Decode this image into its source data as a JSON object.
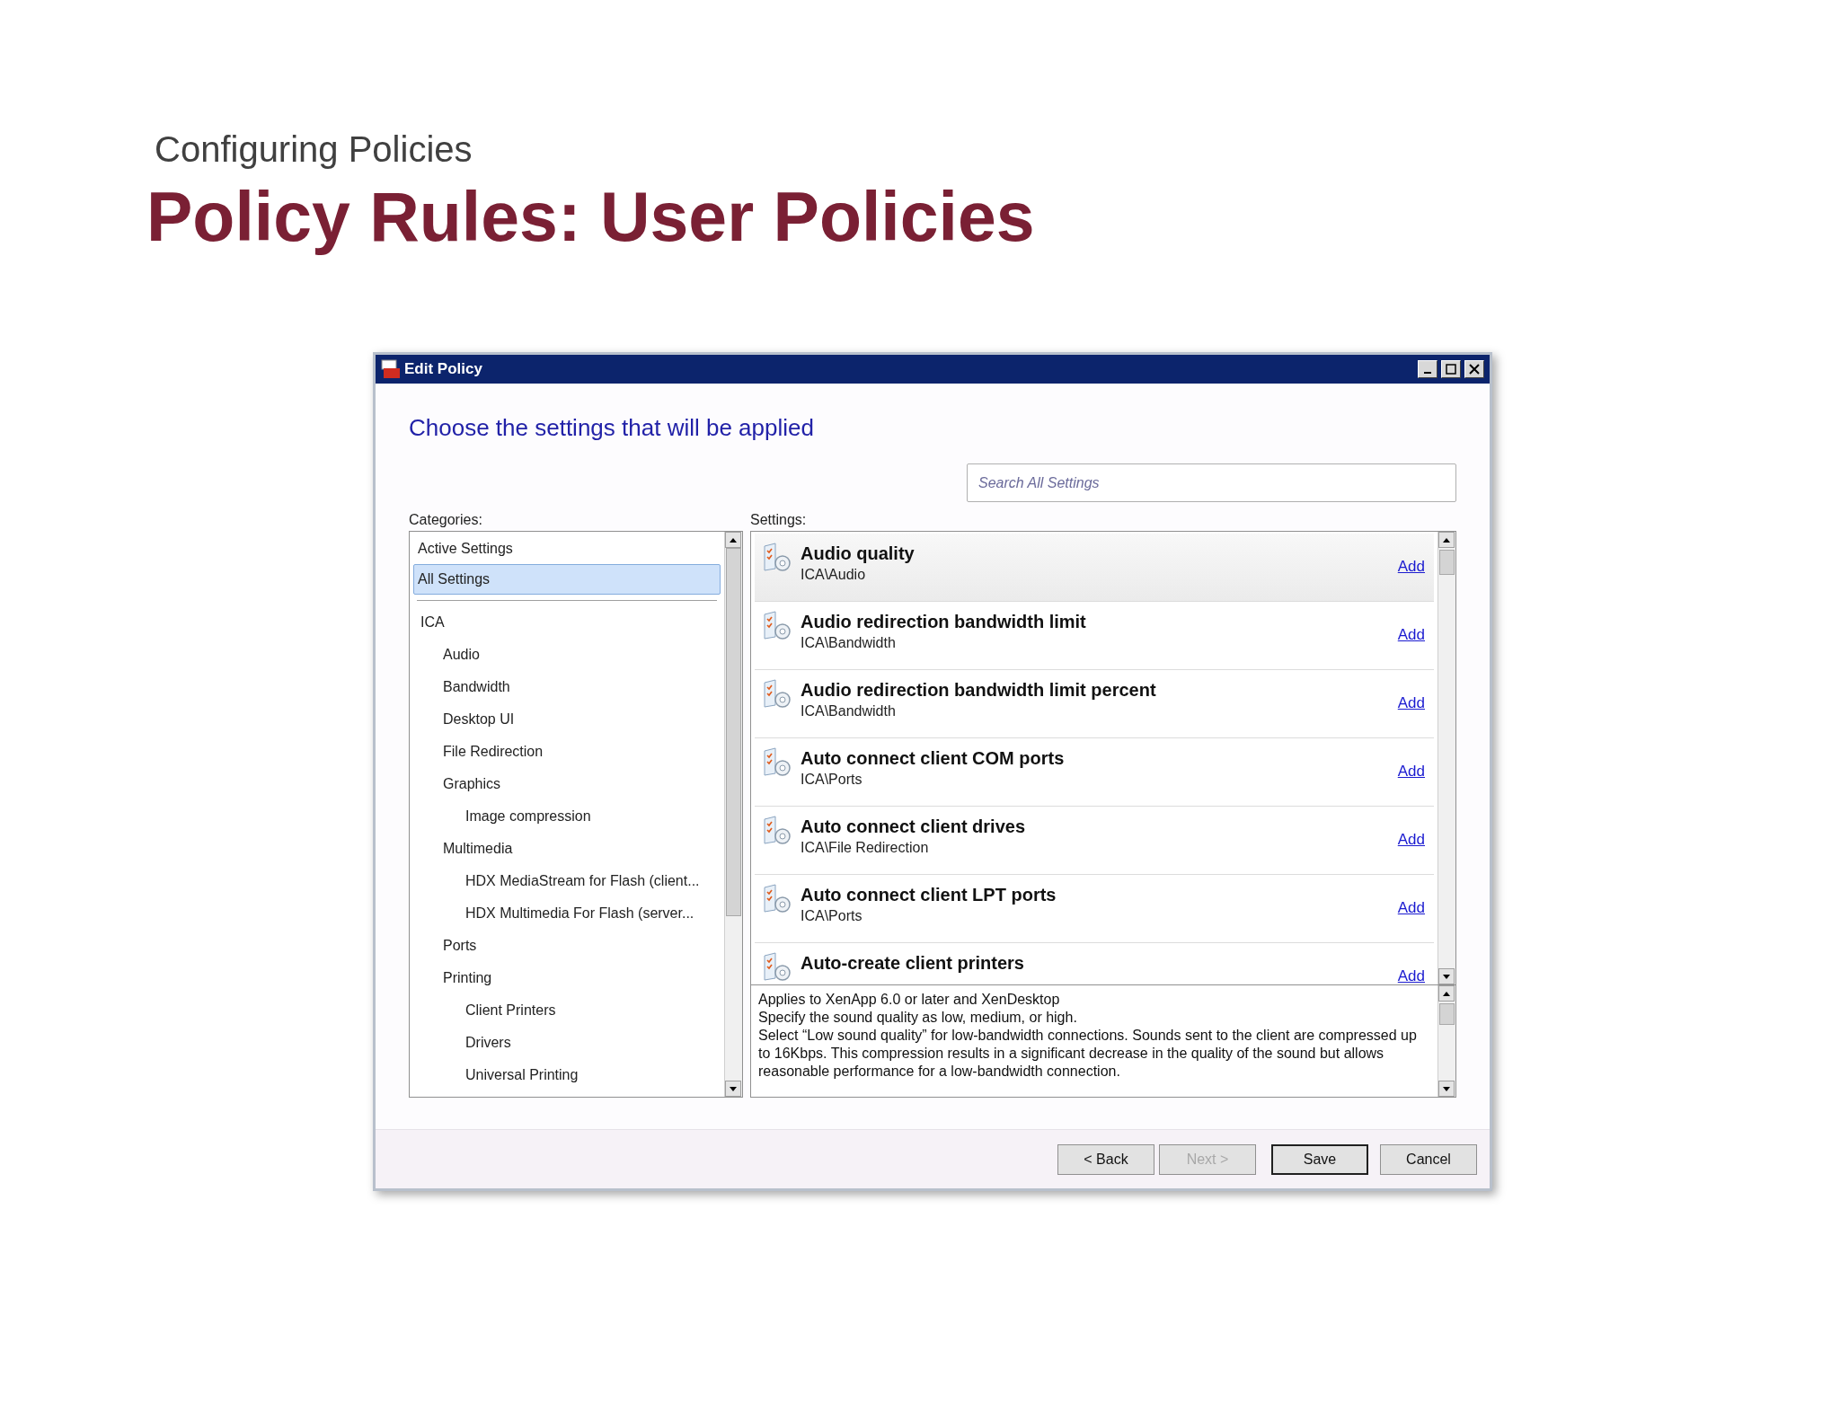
{
  "slide": {
    "subtitle": "Configuring Policies",
    "title": "Policy Rules: User Policies"
  },
  "window": {
    "title": "Edit Policy"
  },
  "heading": "Choose the settings that will be applied",
  "search": {
    "placeholder": "Search All Settings"
  },
  "categories": {
    "label": "Categories:",
    "views": [
      {
        "label": "Active Settings",
        "selected": false
      },
      {
        "label": "All Settings",
        "selected": true
      }
    ],
    "tree": [
      {
        "label": "ICA",
        "children": [
          {
            "label": "Audio"
          },
          {
            "label": "Bandwidth"
          },
          {
            "label": "Desktop UI"
          },
          {
            "label": "File Redirection"
          },
          {
            "label": "Graphics",
            "children": [
              {
                "label": "Image compression"
              }
            ]
          },
          {
            "label": "Multimedia",
            "children": [
              {
                "label": "HDX MediaStream for Flash (client..."
              },
              {
                "label": "HDX Multimedia For Flash (server..."
              }
            ]
          },
          {
            "label": "Ports"
          },
          {
            "label": "Printing",
            "children": [
              {
                "label": "Client Printers"
              },
              {
                "label": "Drivers"
              },
              {
                "label": "Universal Printing"
              }
            ]
          }
        ]
      }
    ]
  },
  "settings": {
    "label": "Settings:",
    "items": [
      {
        "name": "Audio quality",
        "path": "ICA\\Audio",
        "action": "Add",
        "selected": true
      },
      {
        "name": "Audio redirection bandwidth limit",
        "path": "ICA\\Bandwidth",
        "action": "Add",
        "selected": false
      },
      {
        "name": "Audio redirection bandwidth limit percent",
        "path": "ICA\\Bandwidth",
        "action": "Add",
        "selected": false
      },
      {
        "name": "Auto connect client COM ports",
        "path": "ICA\\Ports",
        "action": "Add",
        "selected": false
      },
      {
        "name": "Auto connect client drives",
        "path": "ICA\\File Redirection",
        "action": "Add",
        "selected": false
      },
      {
        "name": "Auto connect client LPT ports",
        "path": "ICA\\Ports",
        "action": "Add",
        "selected": false
      },
      {
        "name": "Auto-create client printers",
        "action": "Add",
        "selected": false
      }
    ]
  },
  "description": [
    "Applies to XenApp 6.0 or later and XenDesktop",
    "Specify the sound quality as low, medium, or high.",
    "Select “Low sound quality” for low-bandwidth connections. Sounds sent to the client are compressed up to 16Kbps. This compression results in a significant decrease in the quality of the sound but allows reasonable performance for a low-bandwidth connection."
  ],
  "buttons": [
    {
      "label": "< Back",
      "disabled": false,
      "default": false
    },
    {
      "label": "Next >",
      "disabled": true,
      "default": false
    },
    {
      "label": "Save",
      "disabled": false,
      "default": true
    },
    {
      "label": "Cancel",
      "disabled": false,
      "default": false
    }
  ]
}
